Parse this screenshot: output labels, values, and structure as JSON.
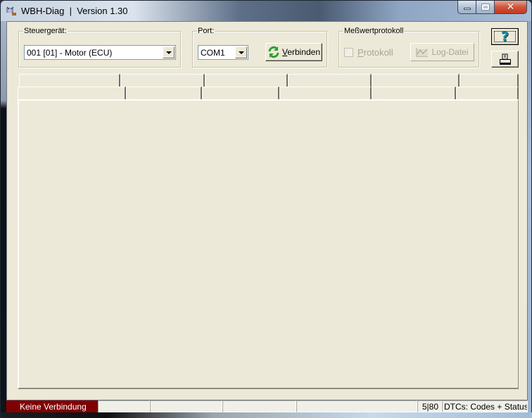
{
  "window": {
    "title": "WBH-Diag  |  Version 1.30",
    "controls": {
      "minimize": "minimize",
      "maximize": "maximize",
      "close": "close"
    }
  },
  "steuergeraet": {
    "legend": "Steuergerät:",
    "selected": "001 [01] - Motor (ECU)"
  },
  "port": {
    "legend": "Port:",
    "selected": "COM1",
    "connect_label_prefix": "V",
    "connect_label_rest": "erbinden",
    "connect_icon": "refresh-icon"
  },
  "messwert": {
    "legend": "Meßwertprotokoll",
    "protokoll_prefix": "P",
    "protokoll_rest": "rotokoll",
    "protokoll_checked": false,
    "logdatei_label": "Log-Datei",
    "logdatei_icon": "chart-icon"
  },
  "side_buttons": {
    "help_glyph": "?",
    "help_icon": "help-icon",
    "print_icon": "printer-icon"
  },
  "header_rows": [
    {
      "cells": [
        "",
        "",
        "",
        "",
        "",
        ""
      ]
    },
    {
      "cells": [
        "",
        "",
        "",
        "",
        "",
        ""
      ]
    }
  ],
  "statusbar": {
    "connection": "Keine Verbindung",
    "cells": [
      "",
      "",
      "",
      "",
      ""
    ],
    "counter": "5|80",
    "mode": "DTCs: Codes + Status"
  },
  "colors": {
    "status_disconnected": "#800000",
    "dialog_bg": "#ece9d8",
    "help_accent": "#1f8aa8",
    "connect_icon_green": "#2e9e2e"
  }
}
